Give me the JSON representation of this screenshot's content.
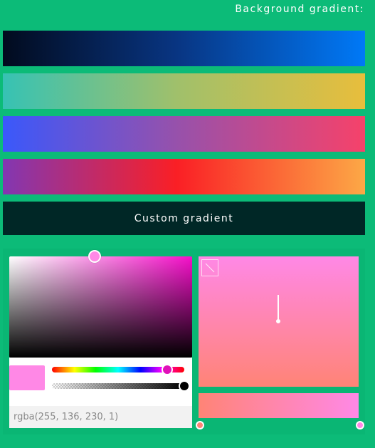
{
  "header": {
    "title": "Background gradient:"
  },
  "presets": [
    {
      "name": "preset-1",
      "colors": [
        "#020b1e",
        "#083582",
        "#0079f7"
      ]
    },
    {
      "name": "preset-2",
      "colors": [
        "#36c2b4",
        "#a0c06b",
        "#e8be3c"
      ]
    },
    {
      "name": "preset-3",
      "colors": [
        "#3a58fb",
        "#9751ab",
        "#f6426a"
      ]
    },
    {
      "name": "preset-4",
      "colors": [
        "#8237b2",
        "#fa1f25",
        "#fca846"
      ]
    }
  ],
  "custom_button": {
    "label": "Custom gradient"
  },
  "picker": {
    "hue_color": "#f50fc9",
    "current_color": "#ff88e6",
    "rgba_value": "rgba(255, 136, 230, 1)"
  },
  "gradient": {
    "stops": [
      "#ff8476",
      "#ff88e6"
    ]
  },
  "colors": {
    "background": "#0cbb78",
    "button_bg": "#002726",
    "text": "#ffffff"
  }
}
